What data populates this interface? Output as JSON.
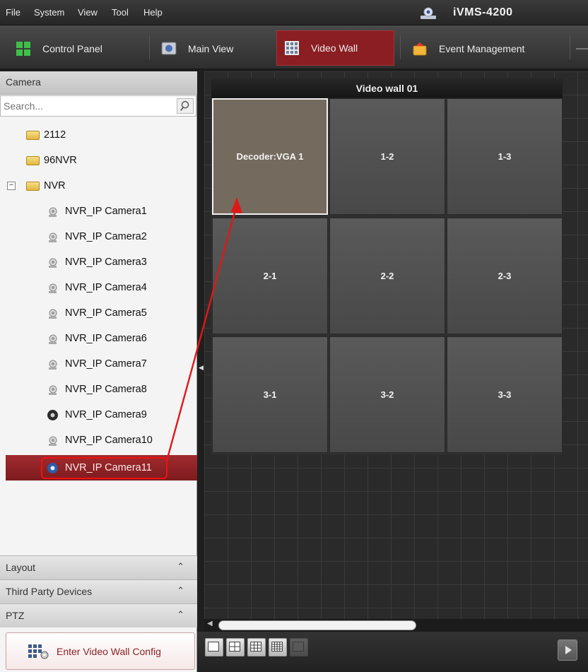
{
  "menubar": {
    "items": [
      "File",
      "System",
      "View",
      "Tool",
      "Help"
    ],
    "app_title": "iVMS-4200"
  },
  "toolbar": {
    "tabs": [
      {
        "label": "Control Panel",
        "icon": "control-panel-icon"
      },
      {
        "label": "Main View",
        "icon": "main-view-icon"
      },
      {
        "label": "Video Wall",
        "icon": "video-wall-icon",
        "active": true
      },
      {
        "label": "Event Management",
        "icon": "event-management-icon"
      }
    ],
    "accent": "#8a1e22"
  },
  "camera_panel": {
    "header": "Camera",
    "search_placeholder": "Search...",
    "tree": [
      {
        "label": "2112",
        "type": "folder"
      },
      {
        "label": "96NVR",
        "type": "folder"
      },
      {
        "label": "NVR",
        "type": "folder",
        "expanded": true
      },
      {
        "label": "NVR_IP Camera1",
        "type": "camera"
      },
      {
        "label": "NVR_IP Camera2",
        "type": "camera"
      },
      {
        "label": "NVR_IP Camera3",
        "type": "camera"
      },
      {
        "label": "NVR_IP Camera4",
        "type": "camera"
      },
      {
        "label": "NVR_IP Camera5",
        "type": "camera"
      },
      {
        "label": "NVR_IP Camera6",
        "type": "camera"
      },
      {
        "label": "NVR_IP Camera7",
        "type": "camera"
      },
      {
        "label": "NVR_IP Camera8",
        "type": "camera"
      },
      {
        "label": "NVR_IP Camera9",
        "type": "camera-online"
      },
      {
        "label": "NVR_IP Camera10",
        "type": "camera"
      },
      {
        "label": "NVR_IP Camera11",
        "type": "camera-online",
        "selected": true
      }
    ]
  },
  "accordion": [
    {
      "label": "Layout"
    },
    {
      "label": "Third Party Devices"
    },
    {
      "label": "PTZ"
    }
  ],
  "footer": {
    "enter_config": "Enter Video Wall Config"
  },
  "video_wall": {
    "title": "Video wall 01",
    "cells": [
      "Decoder:VGA 1",
      "1-2",
      "1-3",
      "2-1",
      "2-2",
      "2-3",
      "3-1",
      "3-2",
      "3-3"
    ],
    "active_cell": "Decoder:VGA 1"
  },
  "layout_buttons": [
    "1x1",
    "2x2",
    "3x3",
    "4x4",
    "custom"
  ]
}
